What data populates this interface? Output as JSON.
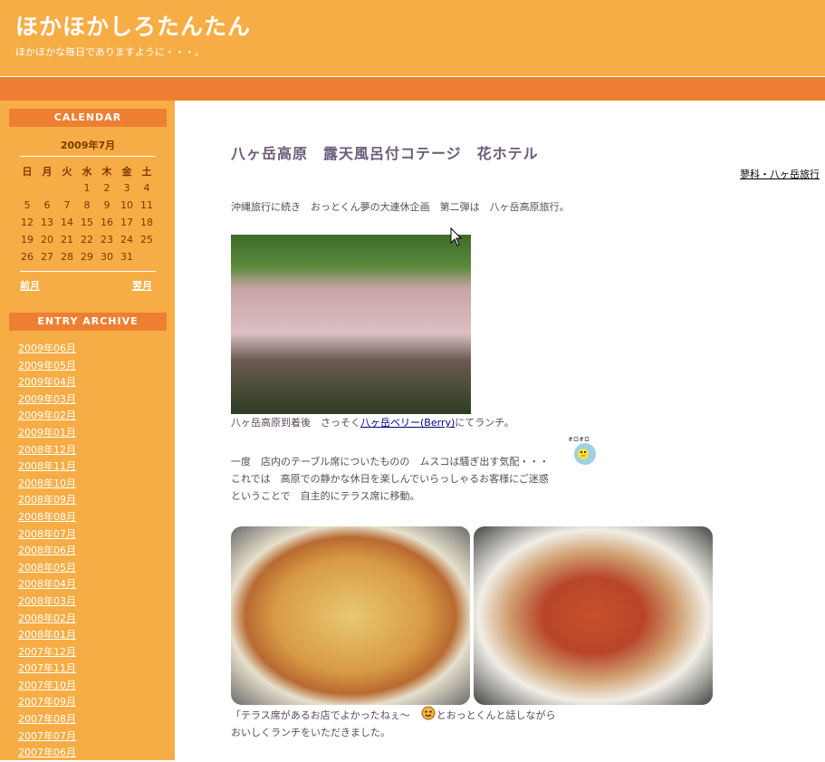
{
  "header": {
    "title": "ほかほかしろたんたん",
    "tagline": "ほかほかな毎日でありますように・・・。"
  },
  "sidebar": {
    "calendar": {
      "heading": "CALENDAR",
      "month": "2009年7月",
      "weekdays": [
        "日",
        "月",
        "火",
        "水",
        "木",
        "金",
        "土"
      ],
      "weeks": [
        [
          "",
          "",
          "",
          "1",
          "2",
          "3",
          "4"
        ],
        [
          "5",
          "6",
          "7",
          "8",
          "9",
          "10",
          "11"
        ],
        [
          "12",
          "13",
          "14",
          "15",
          "16",
          "17",
          "18"
        ],
        [
          "19",
          "20",
          "21",
          "22",
          "23",
          "24",
          "25"
        ],
        [
          "26",
          "27",
          "28",
          "29",
          "30",
          "31",
          ""
        ]
      ],
      "prev_label": "前月",
      "next_label": "翌月"
    },
    "archive": {
      "heading": "ENTRY ARCHIVE",
      "items": [
        "2009年06月",
        "2009年05月",
        "2009年04月",
        "2009年03月",
        "2009年02月",
        "2009年01月",
        "2008年12月",
        "2008年11月",
        "2008年10月",
        "2008年09月",
        "2008年08月",
        "2008年07月",
        "2008年06月",
        "2008年05月",
        "2008年04月",
        "2008年03月",
        "2008年02月",
        "2008年01月",
        "2007年12月",
        "2007年11月",
        "2007年10月",
        "2007年09月",
        "2007年08月",
        "2007年07月",
        "2007年06月"
      ]
    }
  },
  "entry": {
    "title": "八ヶ岳高原　露天風呂付コテージ　花ホテル",
    "category": "蓼科・八ヶ岳旅行",
    "intro": "沖縄旅行に続き　おっとくん夢の大連休企画　第二弾は　八ヶ岳高原旅行。",
    "caption_before_link": "八ヶ岳高原到着後　さっそく",
    "caption_link": "八ヶ岳ベリー(Berry)",
    "caption_after_link": "にてランチ。",
    "para1_line1": "一度　店内のテーブル席についたものの　ムスコは騒ぎ出す気配・・・",
    "para1_line2": "これでは　高原での静かな休日を楽しんでいらっしゃるお客様にご迷惑",
    "para1_line3": "ということで　自主的にテラス席に移動。",
    "emoji_label": "オロオロ",
    "para2_line1_before": "「テラス席があるお店でよかったねぇ〜",
    "para2_line1_after": "」とおっとくんと話しながら",
    "para2_line2": "おいしくランチをいただきました。"
  },
  "colors": {
    "header_bg": "#f7ad45",
    "bar_bg": "#ee7f32",
    "sidebar_bg": "#f7ad45",
    "title_text": "#6b5a7a"
  }
}
